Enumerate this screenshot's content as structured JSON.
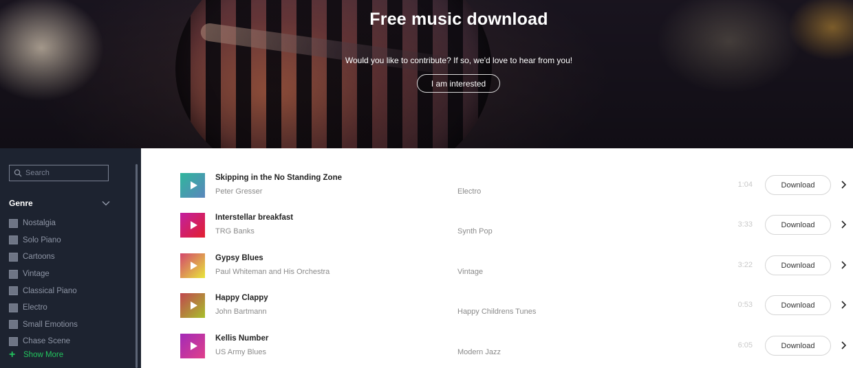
{
  "hero": {
    "title": "Free music download",
    "subtitle": "Would you like to contribute? If so, we'd love to hear from you!",
    "button_label": "I am interested"
  },
  "sidebar": {
    "search_placeholder": "Search",
    "genre_title": "Genre",
    "genres": [
      "Nostalgia",
      "Solo Piano",
      "Cartoons",
      "Vintage",
      "Classical Piano",
      "Electro",
      "Small Emotions",
      "Chase Scene"
    ],
    "show_more": "Show More"
  },
  "tracks": [
    {
      "title": "Skipping in the No Standing Zone",
      "artist": "Peter Gresser",
      "genre": "Electro",
      "duration": "1:04",
      "download": "Download",
      "colors": [
        "#2fb69c",
        "#5b86bd"
      ]
    },
    {
      "title": "Interstellar breakfast",
      "artist": "TRG Banks",
      "genre": "Synth Pop",
      "duration": "3:33",
      "download": "Download",
      "colors": [
        "#c21fa0",
        "#e2212f"
      ]
    },
    {
      "title": "Gypsy Blues",
      "artist": "Paul Whiteman and His Orchestra",
      "genre": "Vintage",
      "duration": "3:22",
      "download": "Download",
      "colors": [
        "#d3476d",
        "#e8e63a"
      ]
    },
    {
      "title": "Happy Clappy",
      "artist": "John Bartmann",
      "genre": "Happy Childrens Tunes",
      "duration": "0:53",
      "download": "Download",
      "colors": [
        "#c0474f",
        "#a8c02b"
      ]
    },
    {
      "title": "Kellis Number",
      "artist": "US Army Blues",
      "genre": "Modern Jazz",
      "duration": "6:05",
      "download": "Download",
      "colors": [
        "#a22ab8",
        "#e0408a"
      ]
    }
  ],
  "colors": {
    "sidebar_bg": "#1d2330",
    "accent_green": "#22c55e"
  },
  "icons": {
    "search": "search-icon",
    "chevron_down": "chevron-down-icon",
    "plus": "plus-icon",
    "play": "play-icon",
    "chevron_right": "chevron-right-icon"
  }
}
